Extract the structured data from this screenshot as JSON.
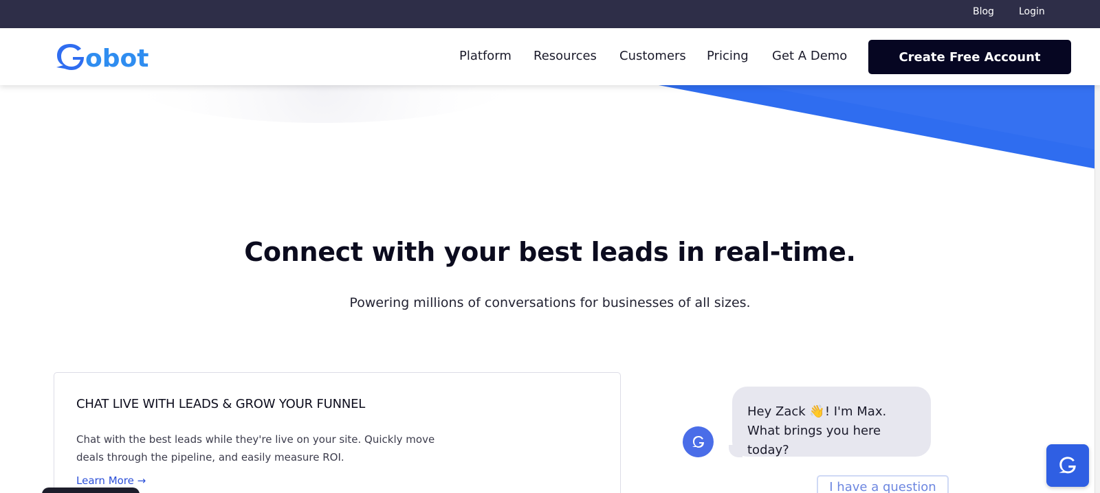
{
  "topbar": {
    "blog_label": "Blog",
    "login_label": "Login"
  },
  "header": {
    "logo_text": "Gobot",
    "nav": {
      "platform": "Platform",
      "resources": "Resources",
      "customers": "Customers",
      "pricing": "Pricing",
      "demo": "Get A Demo"
    },
    "cta_label": "Create Free Account"
  },
  "hero": {
    "title": "Connect with your best leads in real-time.",
    "subtitle": "Powering millions of conversations for businesses of all sizes."
  },
  "card": {
    "title": "CHAT LIVE WITH LEADS & GROW YOUR FUNNEL",
    "body": "Chat with the best leads while they're live on your site. Quickly move deals through the pipeline, and easily measure ROI.",
    "link": "Learn More →"
  },
  "chat": {
    "greeting_part1": "Hey Zack ",
    "wave_emoji": "👋",
    "greeting_part2": "! I'm Max. What brings you here today?",
    "question_button": "I have a question"
  },
  "colors": {
    "topbar_bg": "#2e2e48",
    "brand_blue": "#2f6df0",
    "cta_bg": "#060622",
    "link_blue": "#2b4fd8",
    "bubble_bg": "#e7e7ef"
  },
  "icons": {
    "logo": "gobot-logo-icon",
    "bot_avatar": "chat-bot-icon",
    "launcher": "chat-launcher-icon"
  }
}
